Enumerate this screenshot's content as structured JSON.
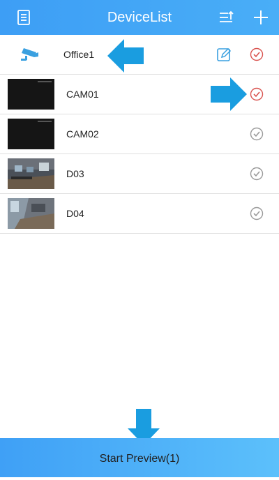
{
  "header": {
    "title": "DeviceList",
    "left_icon": "list-document-icon",
    "sort_icon": "sort-icon",
    "add_icon": "plus-icon"
  },
  "group": {
    "name": "Office1",
    "icon": "cctv-camera-icon",
    "edit_icon": "edit-icon",
    "checked": true
  },
  "devices": [
    {
      "name": "CAM01",
      "checked": true
    },
    {
      "name": "CAM02",
      "checked": false
    },
    {
      "name": "D03",
      "checked": false
    },
    {
      "name": "D04",
      "checked": false
    }
  ],
  "footer": {
    "button_label": "Start Preview(1)"
  },
  "colors": {
    "header_blue": "#3d9ef5",
    "accent_blue": "#3aa0e0",
    "checked_red": "#d9534f",
    "unchecked_gray": "#9a9a9a",
    "arrow_blue": "#1a9de0"
  }
}
